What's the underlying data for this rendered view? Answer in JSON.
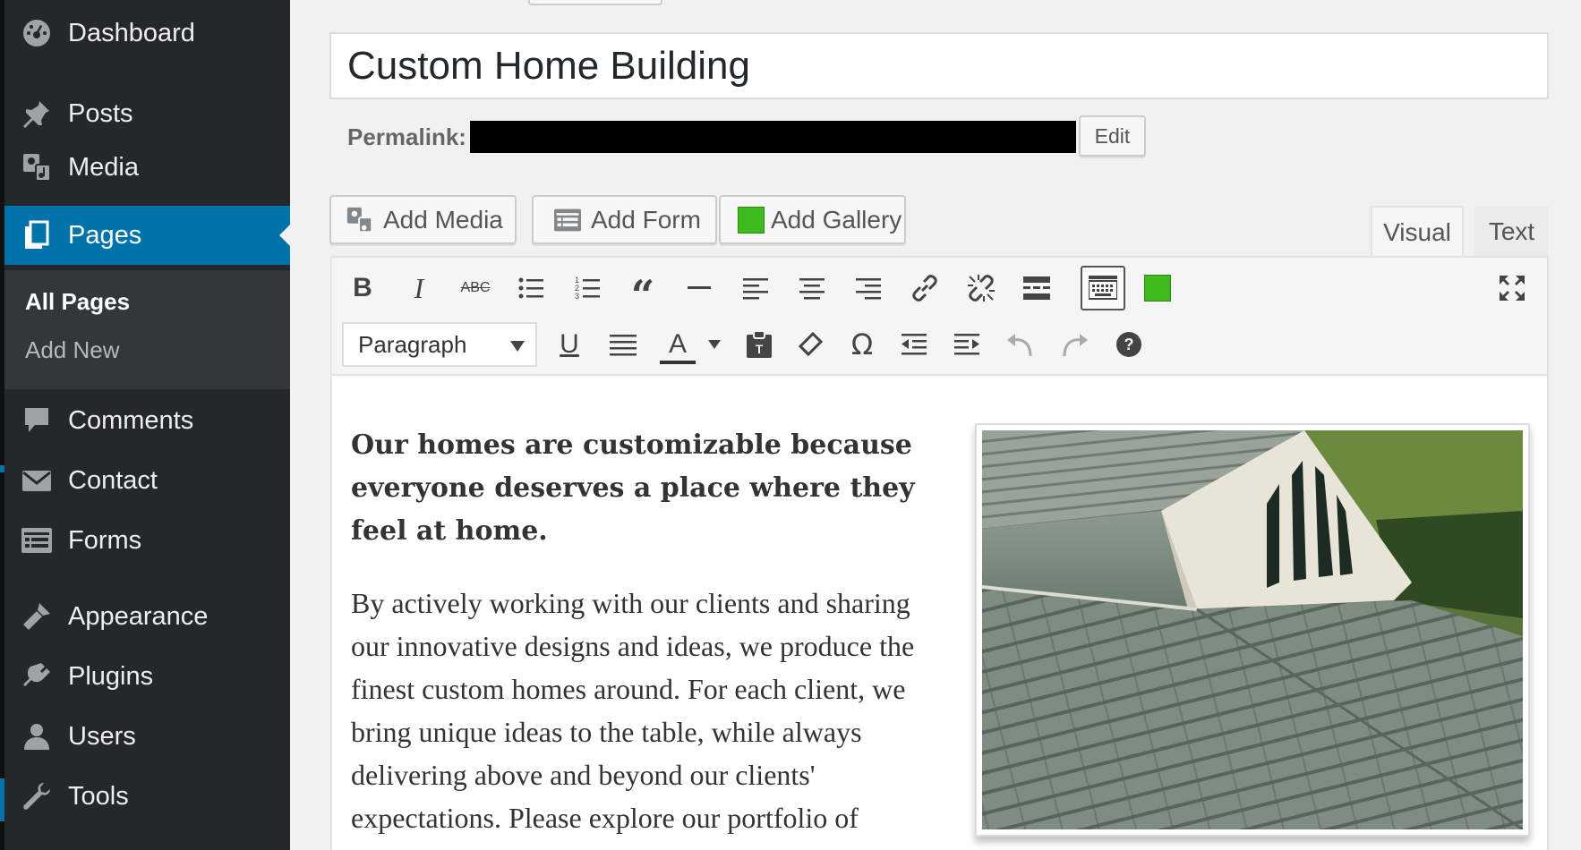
{
  "sidebar": {
    "items": [
      {
        "label": "Dashboard",
        "icon": "dashboard-icon"
      },
      {
        "label": "Posts",
        "icon": "pin-icon"
      },
      {
        "label": "Media",
        "icon": "media-icon"
      },
      {
        "label": "Pages",
        "icon": "pages-icon",
        "active": true
      },
      {
        "label": "Comments",
        "icon": "comment-icon"
      },
      {
        "label": "Contact",
        "icon": "envelope-icon"
      },
      {
        "label": "Forms",
        "icon": "form-icon"
      },
      {
        "label": "Appearance",
        "icon": "brush-icon"
      },
      {
        "label": "Plugins",
        "icon": "plugin-icon"
      },
      {
        "label": "Users",
        "icon": "user-icon"
      },
      {
        "label": "Tools",
        "icon": "wrench-icon"
      }
    ],
    "submenu": [
      {
        "label": "All Pages",
        "current": true
      },
      {
        "label": "Add New"
      }
    ]
  },
  "editor": {
    "title_value": "Custom Home Building",
    "permalink_label": "Permalink:",
    "permalink_edit": "Edit",
    "media_buttons": {
      "add_media": "Add Media",
      "add_form": "Add Form",
      "add_gallery": "Add Gallery"
    },
    "tabs": {
      "visual": "Visual",
      "text": "Text"
    },
    "format_select": "Paragraph",
    "content": {
      "heading": "Our homes are customizable because everyone deserves a place where they feel at home.",
      "paragraph": "By actively working with our clients and sharing our innovative designs and ideas, we produce the finest custom homes around. For each client, we bring unique ideas to the table, while always delivering above and beyond our clients' expectations. Please explore our portfolio of custom homes to find yours."
    }
  },
  "colors": {
    "sidebar_bg": "#23282d",
    "active_bg": "#0073aa",
    "submenu_bg": "#32373c",
    "gallery_green": "#3fba1c"
  }
}
